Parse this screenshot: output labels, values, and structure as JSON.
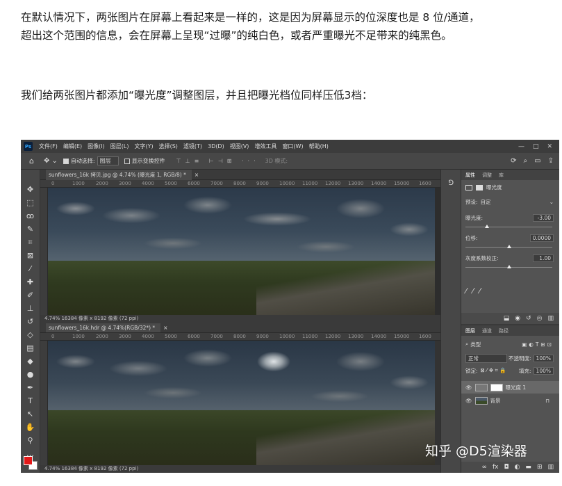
{
  "article": {
    "para1_line1": "在默认情况下，两张图片在屏幕上看起来是一样的，这是因为屏幕显示的位深度也是 8 位/通道，",
    "para1_line2": "超出这个范围的信息，会在屏幕上呈现“过曝”的纯白色，或者严重曝光不足带来的纯黑色。",
    "para2": "我们给两张图片都添加“曝光度”调整图层，并且把曝光档位同样压低3档："
  },
  "photoshop": {
    "logo": "Ps",
    "menu": [
      "文件(F)",
      "编辑(E)",
      "图像(I)",
      "图层(L)",
      "文字(Y)",
      "选择(S)",
      "滤镜(T)",
      "3D(D)",
      "视图(V)",
      "增效工具",
      "窗口(W)",
      "帮助(H)"
    ],
    "window_controls": [
      "—",
      "□",
      "✕"
    ],
    "options": {
      "auto_select_label": "自动选择:",
      "auto_select_value": "图层",
      "show_transform": "显示变换控件",
      "mode_3d": "3D 模式:"
    },
    "doc1": {
      "tab": "sunflowers_16k 拷贝.jpg @ 4.74% (曝光度 1, RGB/8) *",
      "close": "×",
      "status": "4.74%   16384 像素 x 8192 像素 (72 ppi)"
    },
    "doc2": {
      "tab": "sunflowers_16k.hdr @ 4.74%(RGB/32*) *",
      "close": "×",
      "status": "4.74%   16384 像素 x 8192 像素 (72 ppi)"
    },
    "ruler_ticks": [
      "0",
      "1000",
      "2000",
      "3000",
      "4000",
      "5000",
      "6000",
      "7000",
      "8000",
      "9000",
      "10000",
      "11000",
      "12000",
      "13000",
      "14000",
      "15000",
      "1600"
    ],
    "properties": {
      "tabs": [
        "属性",
        "调整",
        "库"
      ],
      "title": "曝光度",
      "preset_label": "预设:",
      "preset_value": "自定",
      "exposure_label": "曝光度:",
      "exposure_value": "-3.00",
      "offset_label": "位移:",
      "offset_value": "0.0000",
      "gamma_label": "灰度系数校正:",
      "gamma_value": "1.00",
      "exposure_fraction": 0.25,
      "offset_fraction": 0.5,
      "gamma_fraction": 0.5
    },
    "layers": {
      "tabs": [
        "图层",
        "通道",
        "路径"
      ],
      "filter_kind": "类型",
      "blend_mode": "正常",
      "opacity_label": "不透明度:",
      "opacity_value": "100%",
      "lock_label": "锁定:",
      "fill_label": "填充:",
      "fill_value": "100%",
      "rows": [
        {
          "name": "曝光度 1"
        },
        {
          "name": "背景"
        }
      ]
    }
  },
  "watermark": "知乎 @D5渲染器"
}
